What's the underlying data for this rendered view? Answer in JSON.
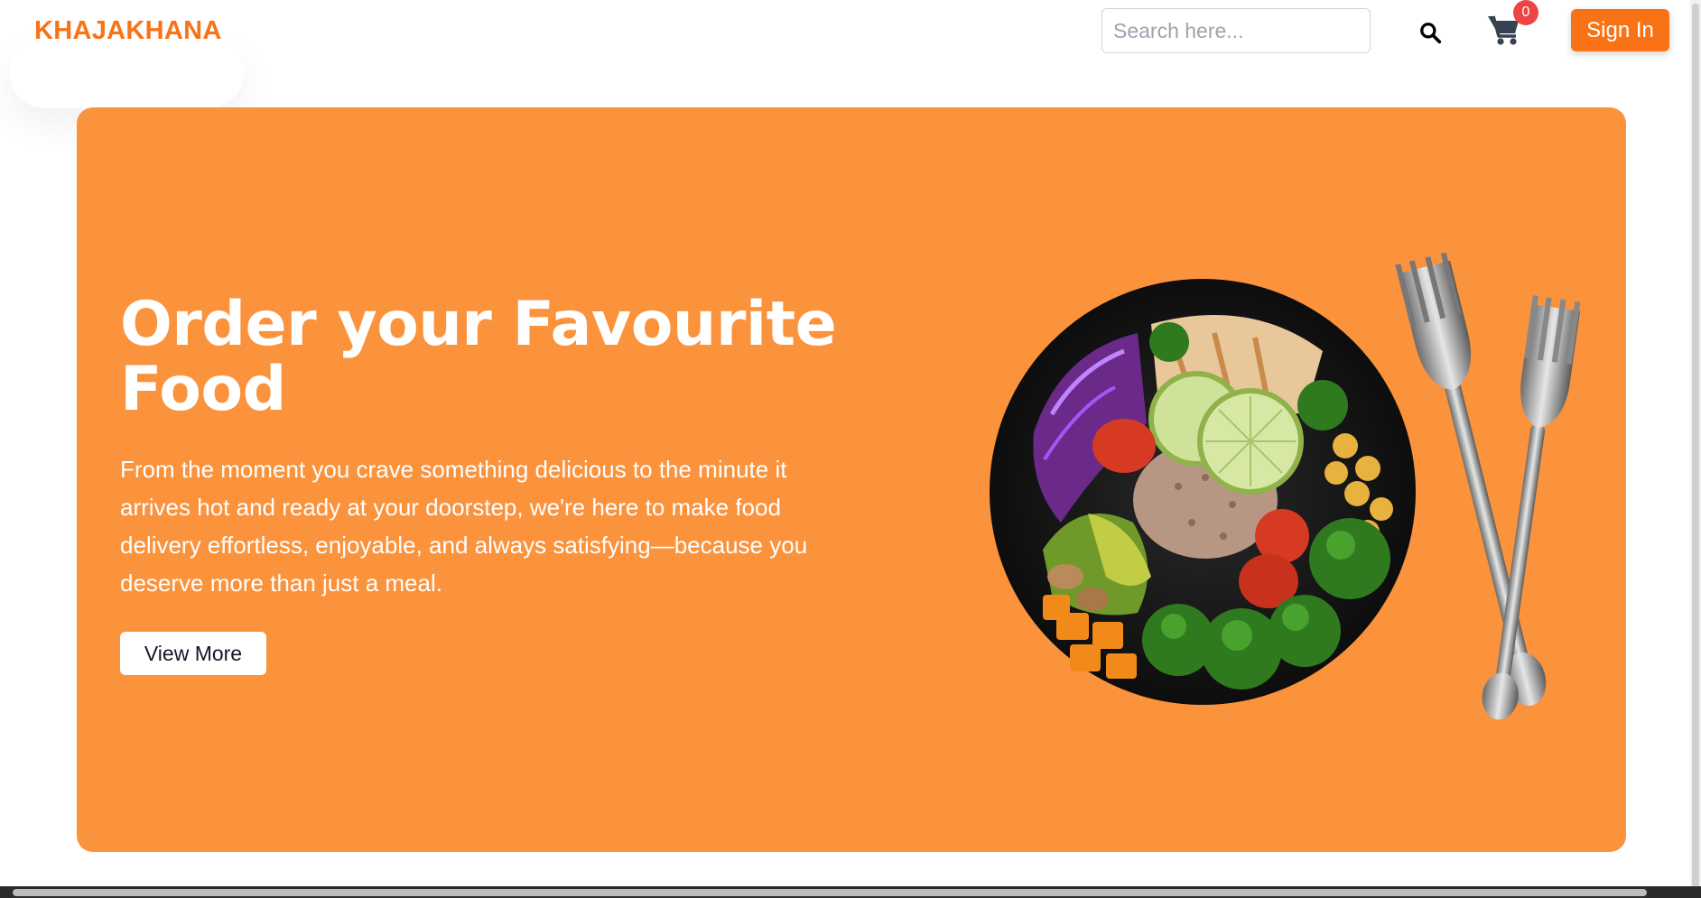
{
  "navbar": {
    "logo": "KHAJAKHANA",
    "search_placeholder": "Search here...",
    "search_icon": "search-icon",
    "cart_icon": "cart-icon",
    "cart_count": "0",
    "signin_label": "Sign In"
  },
  "hero": {
    "title": "Order your Favourite Food",
    "description": "From the moment you crave something delicious to the minute it arrives hot and ready at your doorstep, we're here to make food delivery effortless, enjoyable, and always satisfying—because you deserve more than just a meal.",
    "button_label": "View More",
    "image_icon": "food-bowl-with-forks"
  },
  "colors": {
    "brand": "#f97316",
    "hero_bg": "#fb923c",
    "badge": "#ef4444"
  }
}
